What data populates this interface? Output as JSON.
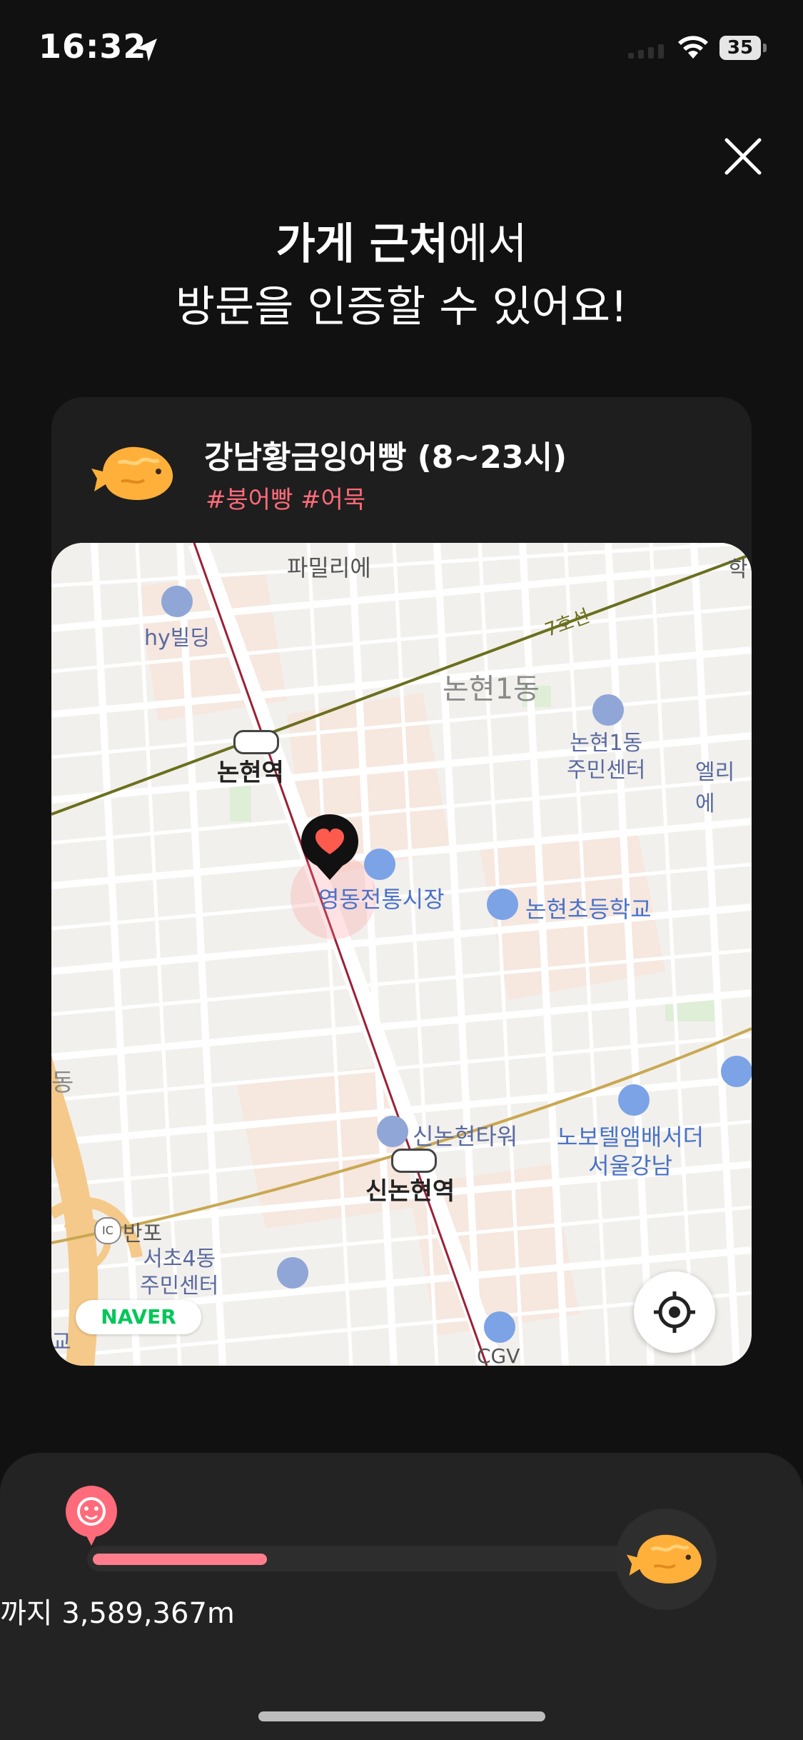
{
  "status_bar": {
    "time": "16:32",
    "battery": "35"
  },
  "header": {
    "title_bold": "가게 근처",
    "title_regular": "에서",
    "title_line2": "방문을 인증할 수 있어요!"
  },
  "store": {
    "name": "강남황금잉어빵 (8~23시)",
    "tags": "#붕어빵 #어묵"
  },
  "map": {
    "labels": {
      "top_cut": "파밀리에",
      "hy": "hy빌딩",
      "line7": "7호선",
      "dong": "논현1동",
      "center1": "논현1동",
      "center1b": "주민센터",
      "right_cut": "엘리에",
      "station1": "논현역",
      "market": "영동전통시장",
      "school": "논현초등학교",
      "tower": "신논현타워",
      "hotel1": "노보텔앰배서더",
      "hotel2": "서울강남",
      "station2": "신논현역",
      "banpo": "반포",
      "ic": "IC",
      "seocho1": "서초4동",
      "seocho2": "주민센터",
      "cgv": "CGV",
      "edge_dong": "동",
      "edge_right": "학",
      "edge_bottom": "교"
    },
    "attribution": "NAVER",
    "store_radius_color": "#ff8a95",
    "subway_line_color": "#9b2135",
    "line7_color": "#6b6f1e"
  },
  "progress": {
    "distance_text": "까지 3,589,367m",
    "fill_ratio": 0.32,
    "accent": "#ff7d8c"
  }
}
